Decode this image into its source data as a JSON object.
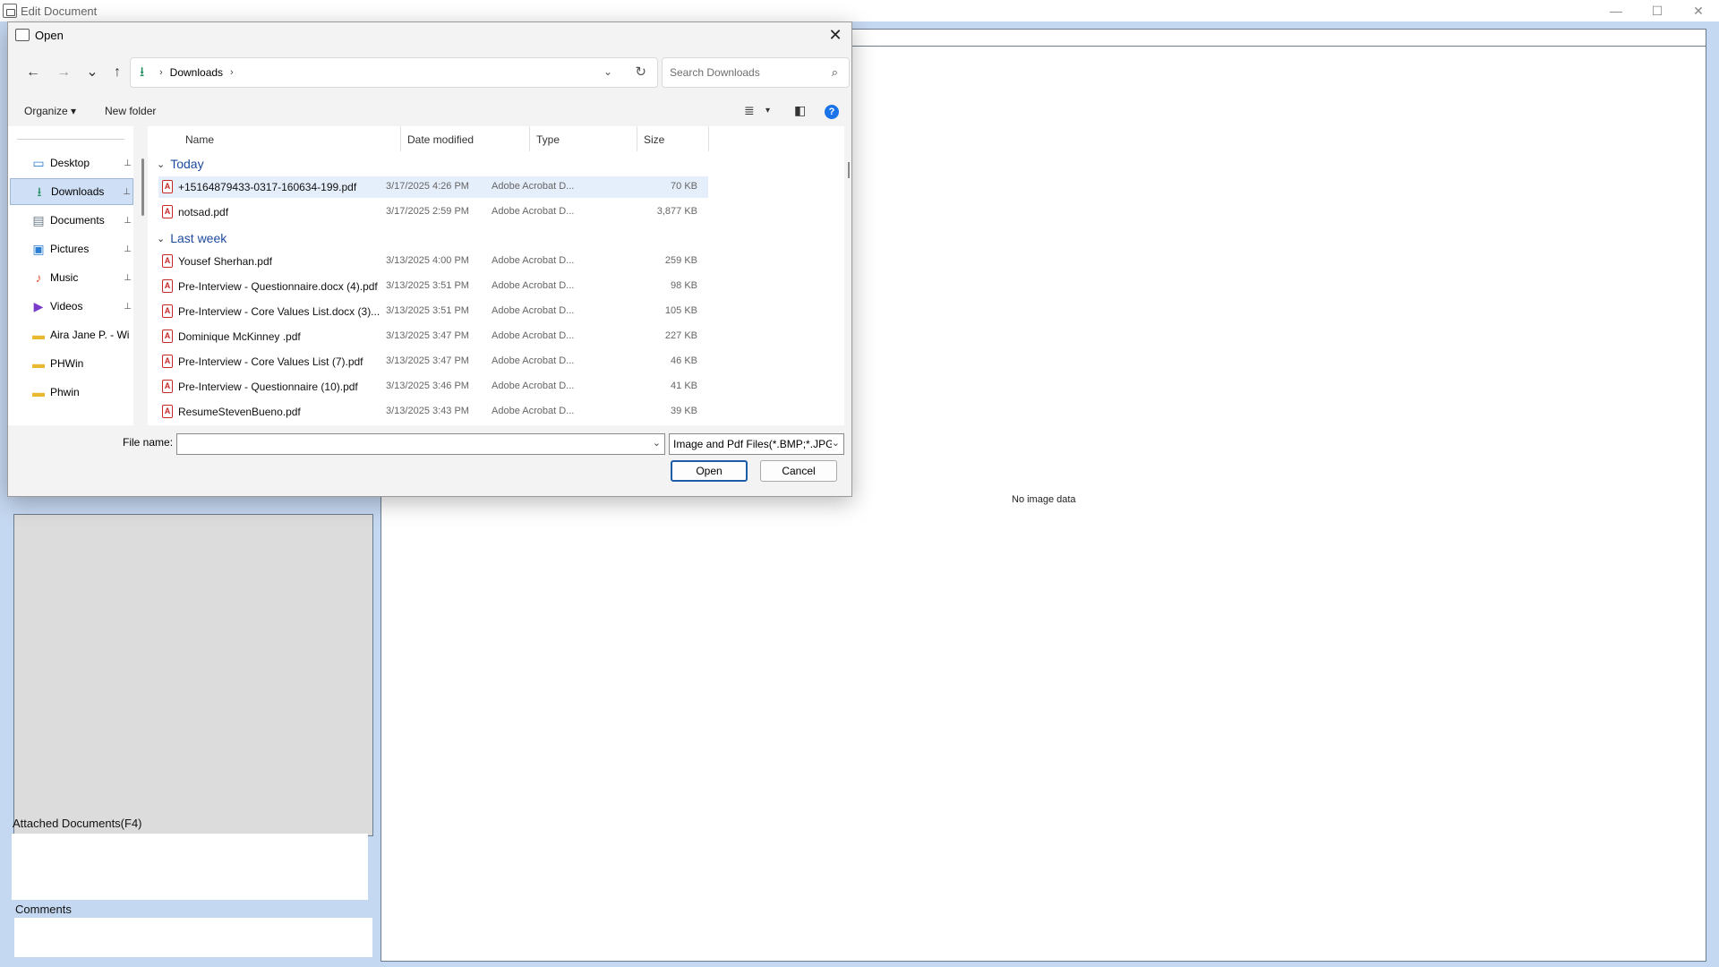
{
  "app": {
    "title": "Edit Document",
    "win_minimize": "—",
    "win_maximize": "☐",
    "win_close": "✕",
    "no_image_text": "No image data",
    "attached_label": "Attached Documents(F4)",
    "comments_label": "Comments"
  },
  "dialog": {
    "title": "Open",
    "close_glyph": "✕",
    "nav": {
      "back": "←",
      "forward": "→",
      "recent": "⌄",
      "up": "↑"
    },
    "address": {
      "icon": "⭳",
      "sep1": "›",
      "folder": "Downloads",
      "sep2": "›",
      "dropdown": "⌄",
      "refresh": "↻"
    },
    "search": {
      "placeholder": "Search Downloads",
      "icon": "⌕"
    },
    "commands": {
      "organize": "Organize ▾",
      "new_folder": "New folder",
      "view_icon": "≣",
      "view_dd": "▾",
      "pane_icon": "◧",
      "help": "?"
    },
    "nav_items": [
      {
        "label": "Desktop",
        "icon": "▭",
        "color": "#2d7fd3",
        "pinned": true
      },
      {
        "label": "Downloads",
        "icon": "⭳",
        "color": "#1a8a5a",
        "pinned": true,
        "selected": true
      },
      {
        "label": "Documents",
        "icon": "▤",
        "color": "#6a7a8a",
        "pinned": true
      },
      {
        "label": "Pictures",
        "icon": "▣",
        "color": "#2d7fd3",
        "pinned": true
      },
      {
        "label": "Music",
        "icon": "♪",
        "color": "#e0583c",
        "pinned": true
      },
      {
        "label": "Videos",
        "icon": "▶",
        "color": "#7a3cc8",
        "pinned": true
      },
      {
        "label": "Aira Jane P. - Wi",
        "icon": "▬",
        "color": "#e8b830",
        "pinned": false
      },
      {
        "label": "PHWin",
        "icon": "▬",
        "color": "#e8b830",
        "pinned": false
      },
      {
        "label": "Phwin",
        "icon": "▬",
        "color": "#e8b830",
        "pinned": false
      }
    ],
    "pin_glyph": "📌",
    "columns": {
      "name": "Name",
      "date": "Date modified",
      "type": "Type",
      "size": "Size"
    },
    "groups": {
      "today": {
        "label": "Today",
        "chevron": "⌄"
      },
      "last_week": {
        "label": "Last week",
        "chevron": "⌄"
      }
    },
    "files_today": [
      {
        "name": "+15164879433-0317-160634-199.pdf",
        "date": "3/17/2025 4:26 PM",
        "type": "Adobe Acrobat D...",
        "size": "70 KB",
        "selected": true
      },
      {
        "name": "notsad.pdf",
        "date": "3/17/2025 2:59 PM",
        "type": "Adobe Acrobat D...",
        "size": "3,877 KB"
      }
    ],
    "files_last_week": [
      {
        "name": "Yousef Sherhan.pdf",
        "date": "3/13/2025 4:00 PM",
        "type": "Adobe Acrobat D...",
        "size": "259 KB"
      },
      {
        "name": "Pre-Interview - Questionnaire.docx (4).pdf",
        "date": "3/13/2025 3:51 PM",
        "type": "Adobe Acrobat D...",
        "size": "98 KB"
      },
      {
        "name": "Pre-Interview - Core Values List.docx (3)....",
        "date": "3/13/2025 3:51 PM",
        "type": "Adobe Acrobat D...",
        "size": "105 KB"
      },
      {
        "name": "Dominique McKinney .pdf",
        "date": "3/13/2025 3:47 PM",
        "type": "Adobe Acrobat D...",
        "size": "227 KB"
      },
      {
        "name": "Pre-Interview - Core Values List (7).pdf",
        "date": "3/13/2025 3:47 PM",
        "type": "Adobe Acrobat D...",
        "size": "46 KB"
      },
      {
        "name": "Pre-Interview - Questionnaire (10).pdf",
        "date": "3/13/2025 3:46 PM",
        "type": "Adobe Acrobat D...",
        "size": "41 KB"
      },
      {
        "name": "ResumeStevenBueno.pdf",
        "date": "3/13/2025 3:43 PM",
        "type": "Adobe Acrobat D...",
        "size": "39 KB"
      }
    ],
    "file_name_label": "File name:",
    "file_name_value": "",
    "file_type_filter": "Image and Pdf Files(*.BMP;*.JPG",
    "open_button": "Open",
    "cancel_button": "Cancel",
    "dropdown_glyph": "⌄"
  }
}
